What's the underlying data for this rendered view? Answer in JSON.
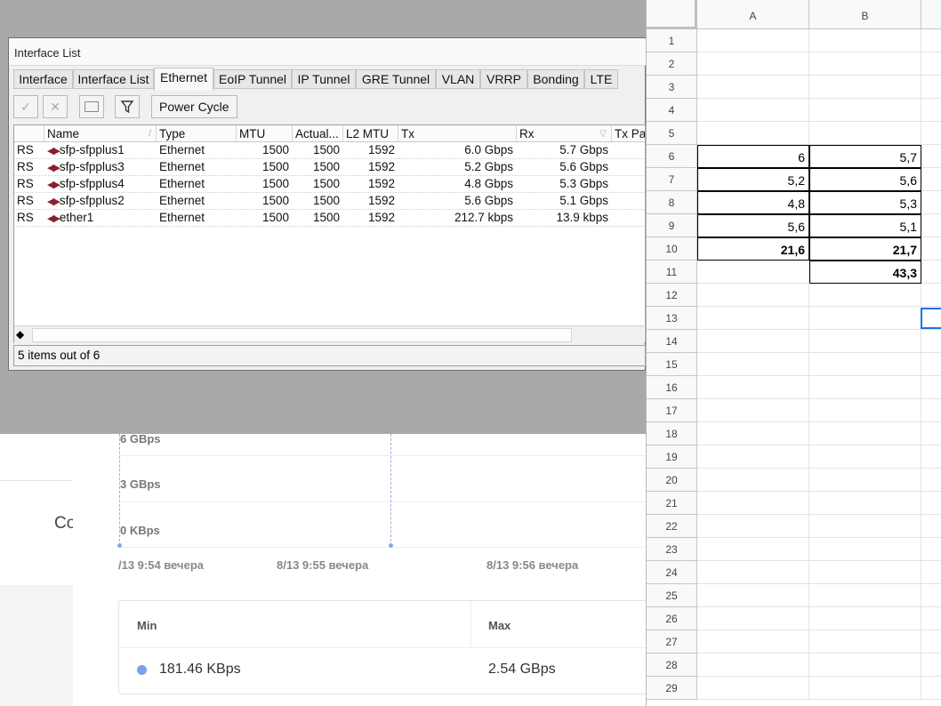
{
  "window": {
    "title": "Interface List",
    "tabs": [
      "Interface",
      "Interface List",
      "Ethernet",
      "EoIP Tunnel",
      "IP Tunnel",
      "GRE Tunnel",
      "VLAN",
      "VRRP",
      "Bonding",
      "LTE"
    ],
    "active_tab": "Ethernet",
    "toolbar": {
      "enable_icon": "check-icon",
      "disable_icon": "x-icon",
      "comment_icon": "note-icon",
      "filter_icon": "filter-icon",
      "power_cycle_label": "Power Cycle"
    },
    "columns": [
      "",
      "Name",
      "Type",
      "MTU",
      "Actual...",
      "L2 MTU",
      "Tx",
      "Rx",
      "Tx Pa"
    ],
    "rows": [
      {
        "flags": "RS",
        "name": "sfp-sfpplus1",
        "type": "Ethernet",
        "mtu": "1500",
        "actual": "1500",
        "l2mtu": "1592",
        "tx": "6.0 Gbps",
        "rx": "5.7 Gbps"
      },
      {
        "flags": "RS",
        "name": "sfp-sfpplus3",
        "type": "Ethernet",
        "mtu": "1500",
        "actual": "1500",
        "l2mtu": "1592",
        "tx": "5.2 Gbps",
        "rx": "5.6 Gbps"
      },
      {
        "flags": "RS",
        "name": "sfp-sfpplus4",
        "type": "Ethernet",
        "mtu": "1500",
        "actual": "1500",
        "l2mtu": "1592",
        "tx": "4.8 Gbps",
        "rx": "5.3 Gbps"
      },
      {
        "flags": "RS",
        "name": "sfp-sfpplus2",
        "type": "Ethernet",
        "mtu": "1500",
        "actual": "1500",
        "l2mtu": "1592",
        "tx": "5.6 Gbps",
        "rx": "5.1 Gbps"
      },
      {
        "flags": "RS",
        "name": "ether1",
        "type": "Ethernet",
        "mtu": "1500",
        "actual": "1500",
        "l2mtu": "1592",
        "tx": "212.7 kbps",
        "rx": "13.9 kbps"
      }
    ],
    "scroll_arrow": "◆",
    "status": "5 items out of 6"
  },
  "background_page": {
    "partial_text": "Co",
    "y_ticks": [
      "6 GBps",
      "3 GBps",
      "0 KBps"
    ],
    "x_ticks": [
      "/13 9:54 вечера",
      "8/13 9:55 вечера",
      "8/13 9:56 вечера"
    ],
    "stats": {
      "min_label": "Min",
      "max_label": "Max",
      "min_value": "181.46 KBps",
      "max_value": "2.54 GBps",
      "series_color": "#7ca0e6"
    }
  },
  "spreadsheet": {
    "columns": [
      "A",
      "B"
    ],
    "row_numbers": [
      "1",
      "2",
      "3",
      "4",
      "5",
      "6",
      "7",
      "8",
      "9",
      "10",
      "11",
      "12",
      "13",
      "14",
      "15",
      "16",
      "17",
      "18",
      "19",
      "20",
      "21",
      "22",
      "23",
      "24",
      "25",
      "26",
      "27",
      "28",
      "29"
    ],
    "cells": {
      "A6": "6",
      "B6": "5,7",
      "A7": "5,2",
      "B7": "5,6",
      "A8": "4,8",
      "B8": "5,3",
      "A9": "5,6",
      "B9": "5,1",
      "A10": "21,6",
      "B10": "21,7",
      "B11": "43,3"
    },
    "selection_color": "#1a73e8"
  }
}
